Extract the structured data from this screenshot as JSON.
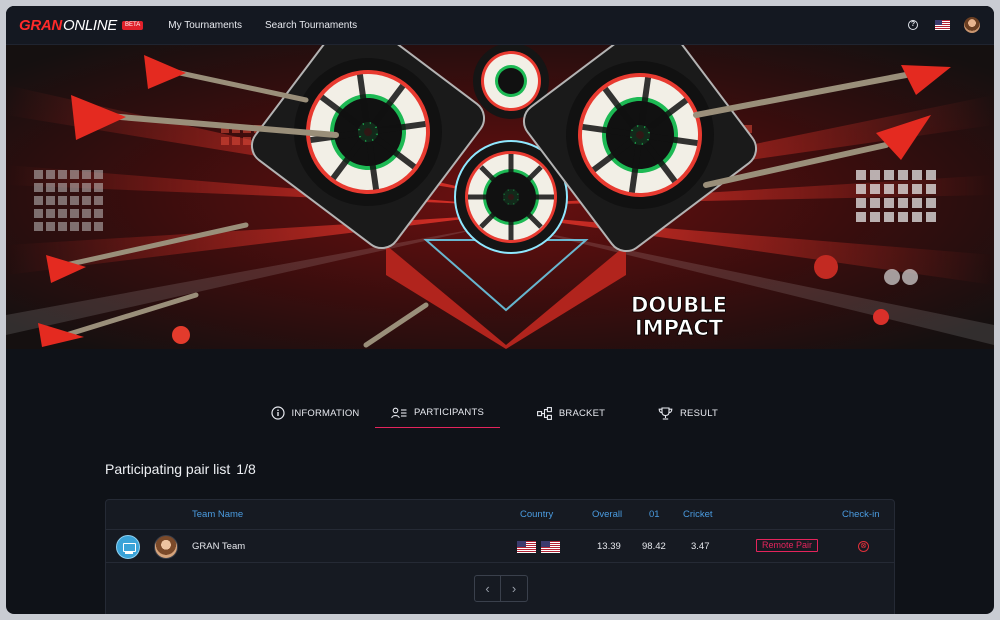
{
  "nav": {
    "logo_primary": "GRAN",
    "logo_secondary": "ONLINE",
    "beta_badge": "BETA",
    "links": [
      "My Tournaments",
      "Search Tournaments"
    ],
    "help_icon": "?"
  },
  "banner": {
    "title_line1": "DOUBLE",
    "title_line2": "IMPACT"
  },
  "tabs": [
    {
      "label": "INFORMATION",
      "icon": "info-icon"
    },
    {
      "label": "PARTICIPANTS",
      "icon": "participants-icon",
      "active": true
    },
    {
      "label": "BRACKET",
      "icon": "bracket-icon"
    },
    {
      "label": "RESULT",
      "icon": "trophy-icon"
    }
  ],
  "list": {
    "title": "Participating pair list",
    "count": "1/8",
    "columns": {
      "team_name": "Team Name",
      "country": "Country",
      "overall": "Overall",
      "o1": "01",
      "cricket": "Cricket",
      "checkin": "Check-in"
    },
    "rows": [
      {
        "team_name": "GRAN Team",
        "overall": "13.39",
        "o1": "98.42",
        "cricket": "3.47",
        "pair_type": "Remote Pair",
        "checkin_status": "⊗"
      }
    ],
    "pager": {
      "prev": "‹",
      "next": "›"
    }
  },
  "colors": {
    "accent": "#e4245c",
    "header_blue": "#4a9be0",
    "logo_red": "#ff2a2a"
  }
}
